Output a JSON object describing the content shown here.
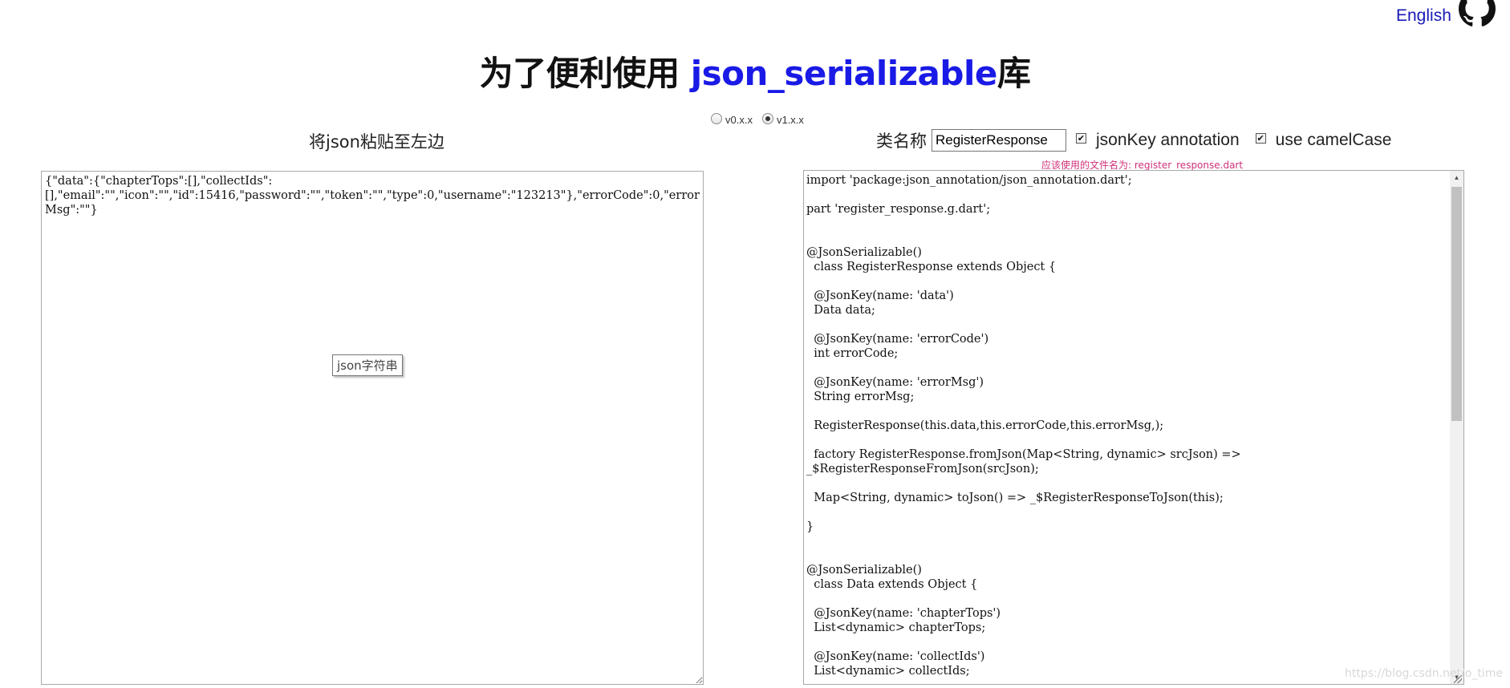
{
  "header": {
    "lang_link": "English",
    "title_prefix": "为了便利使用 ",
    "title_library": "json_serializable",
    "title_suffix": "库"
  },
  "version": {
    "options": [
      {
        "label": "v0.x.x",
        "checked": false
      },
      {
        "label": "v1.x.x",
        "checked": true
      }
    ]
  },
  "left_panel": {
    "label": "将json粘贴至左边",
    "json_value": "{\"data\":{\"chapterTops\":[],\"collectIds\":\n[],\"email\":\"\",\"icon\":\"\",\"id\":15416,\"password\":\"\",\"token\":\"\",\"type\":0,\"username\":\"123213\"},\"errorCode\":0,\"errorMsg\":\"\"}",
    "tooltip": "json字符串"
  },
  "right_panel": {
    "class_name_label": "类名称",
    "class_name_value": "RegisterResponse",
    "json_key_checked": true,
    "json_key_label": "jsonKey annotation",
    "camel_case_checked": true,
    "camel_case_label": "use camelCase",
    "filename_hint": "应该使用的文件名为: register_response.dart",
    "code_output": "import 'package:json_annotation/json_annotation.dart';\n\npart 'register_response.g.dart';\n\n\n@JsonSerializable()\n  class RegisterResponse extends Object {\n\n  @JsonKey(name: 'data')\n  Data data;\n\n  @JsonKey(name: 'errorCode')\n  int errorCode;\n\n  @JsonKey(name: 'errorMsg')\n  String errorMsg;\n\n  RegisterResponse(this.data,this.errorCode,this.errorMsg,);\n\n  factory RegisterResponse.fromJson(Map<String, dynamic> srcJson) =>\n_$RegisterResponseFromJson(srcJson);\n\n  Map<String, dynamic> toJson() => _$RegisterResponseToJson(this);\n\n}\n\n\n@JsonSerializable()\n  class Data extends Object {\n\n  @JsonKey(name: 'chapterTops')\n  List<dynamic> chapterTops;\n\n  @JsonKey(name: 'collectIds')\n  List<dynamic> collectIds;"
  },
  "watermark": "https://blog.csdn.net/o_time",
  "colors": {
    "link": "#1a1ab8",
    "title_library": "#1a1ae6",
    "filename_hint": "#d0307a"
  },
  "icons": {
    "github": "github-icon"
  }
}
